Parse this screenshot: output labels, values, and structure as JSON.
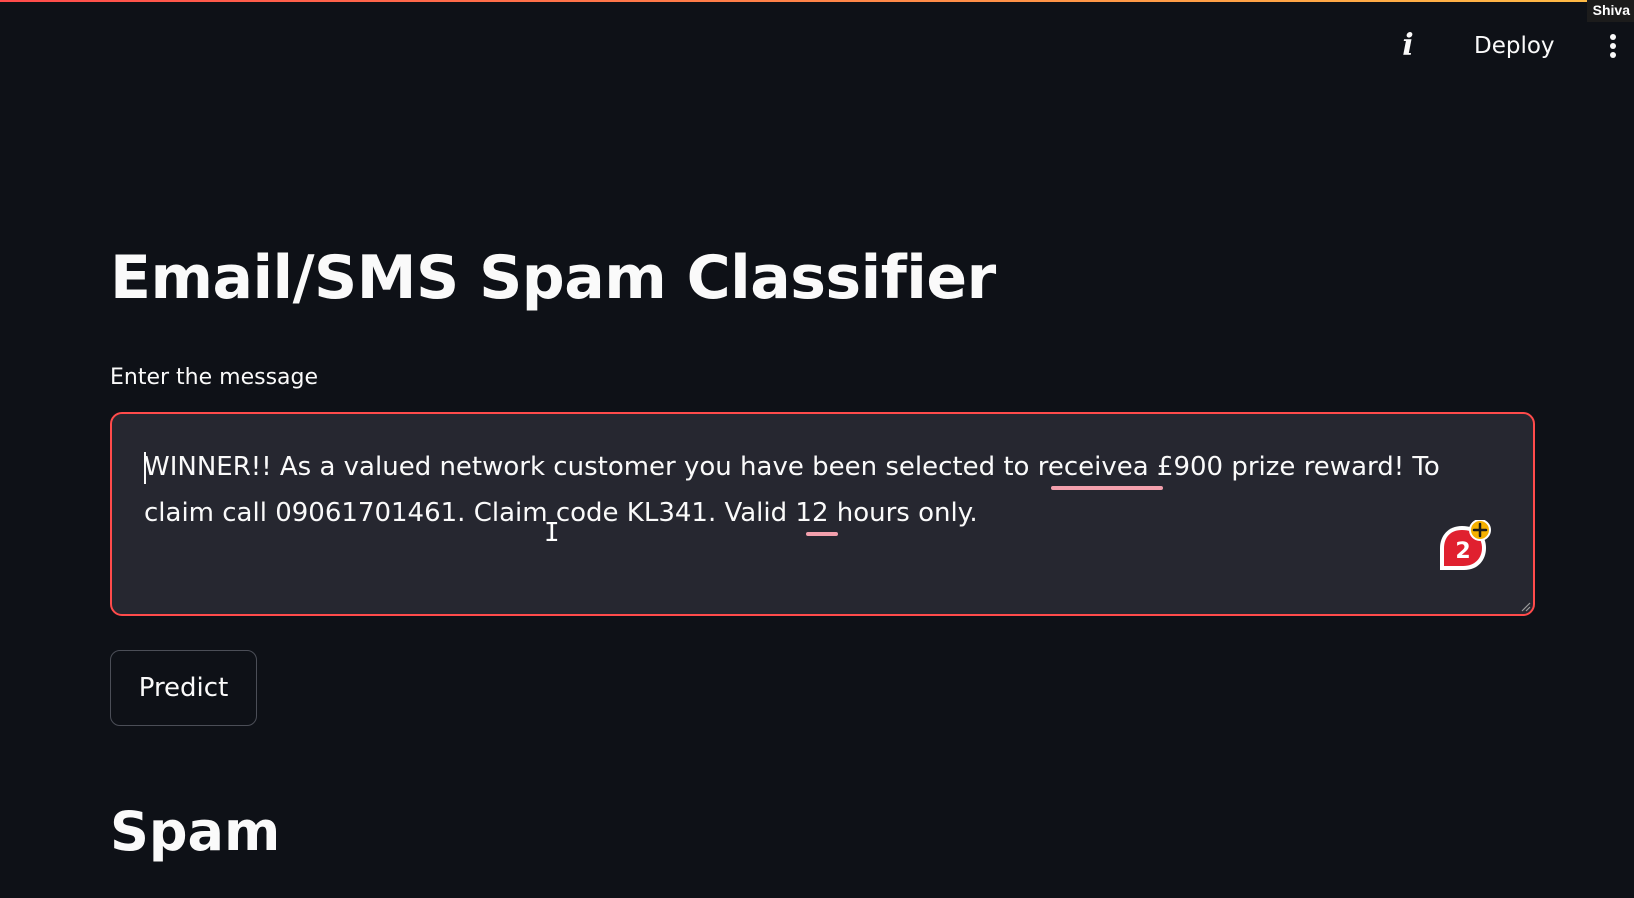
{
  "header": {
    "info_icon": "info-icon",
    "deploy_label": "Deploy",
    "menu_icon": "vertical-dots-icon",
    "user_tag": "Shiva"
  },
  "main": {
    "title": "Email/SMS Spam Classifier",
    "input_label": "Enter the message",
    "message": "WINNER!! As a valued network customer you have been selected to receivea £900 prize reward! To claim call 09061701461. Claim code KL341. Valid 12 hours only.",
    "misspelled_words": [
      "receivea",
      "12"
    ],
    "grammar_badge_count": "2",
    "predict_label": "Predict",
    "result": "Spam"
  },
  "colors": {
    "background": "#0e1117",
    "input_background": "#262730",
    "focus_border": "#ff4b4b",
    "text": "#fafafa",
    "spellcheck_underline": "#f3a0ad",
    "grammar_badge": "#e0202f"
  }
}
